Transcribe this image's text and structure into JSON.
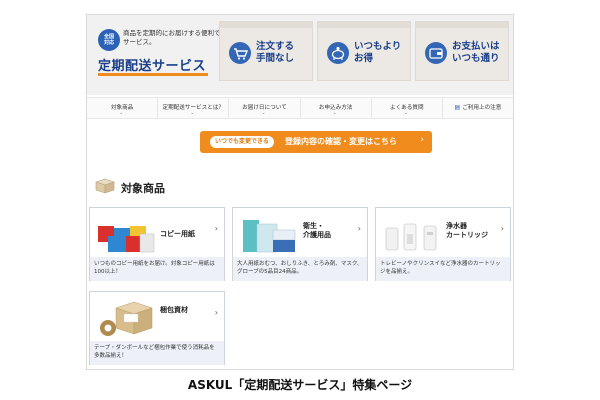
{
  "hero": {
    "badge": "全国\n対応",
    "intro": "商品を定期的にお届けする便利でお得なサービス。",
    "title": "定期配送サービス",
    "features": [
      {
        "icon": "cart-icon",
        "text": "注文する\n手間なし"
      },
      {
        "icon": "piggy-bank-icon",
        "text": "いつもより\nお得"
      },
      {
        "icon": "wallet-icon",
        "text": "お支払いは\nいつも通り"
      }
    ]
  },
  "nav": {
    "items": [
      {
        "label": "対象商品"
      },
      {
        "label": "定期配送サービスとは？"
      },
      {
        "label": "お届け日について"
      },
      {
        "label": "お申込み方法"
      },
      {
        "label": "よくある質問"
      },
      {
        "label": "ご利用上の注意"
      }
    ]
  },
  "cta": {
    "tag": "いつでも変更できる",
    "label": "登録内容の確認・変更はこちら"
  },
  "section": {
    "title": "対象商品"
  },
  "products": [
    {
      "name": "コピー用紙",
      "desc": "いつものコピー用紙をお届け。対象コピー用紙は100以上！"
    },
    {
      "name": "衛生・\n介護用品",
      "desc": "大人用紙おむつ、おしりふき、とろみ剤、マスク、グローブの5品目24商品。"
    },
    {
      "name": "浄水器\nカートリッジ",
      "desc": "トレビーノやクリンスイなど浄水器のカートリッジを品揃え。"
    },
    {
      "name": "梱包資材",
      "desc": "テープ・ダンボールなど梱包作業で使う消耗品を多数品揃え！"
    }
  ],
  "caption": "ASKUL「定期配送サービス」特集ページ",
  "colors": {
    "accent": "#f08c1e",
    "brand": "#1a3f8a",
    "icon_blue": "#3366b4"
  }
}
